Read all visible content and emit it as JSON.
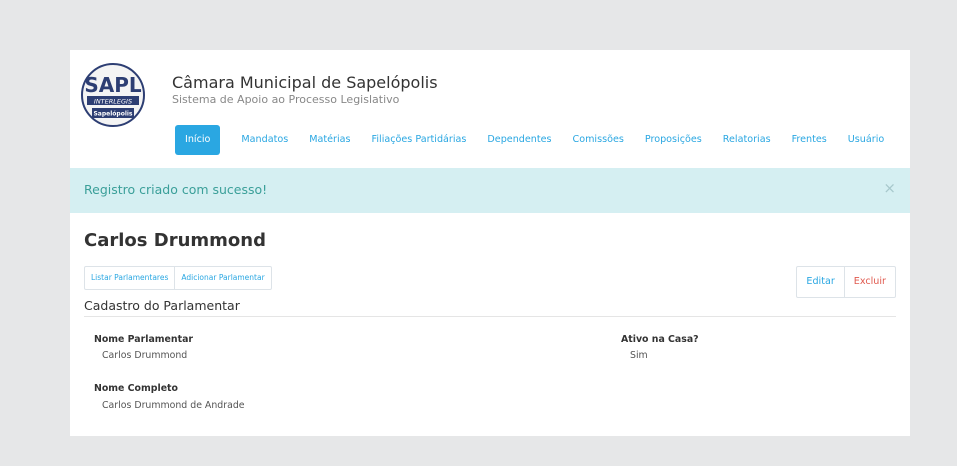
{
  "app": {
    "title": "Câmara Municipal de Sapelópolis",
    "subtitle": "Sistema de Apoio ao Processo Legislativo",
    "logo": {
      "wordmark": "SAPL",
      "band": "INTERLEGIS",
      "caption": "Sapelópolis"
    }
  },
  "nav": {
    "items": [
      {
        "label": "Início",
        "active": true
      },
      {
        "label": "Mandatos",
        "active": false
      },
      {
        "label": "Matérias",
        "active": false
      },
      {
        "label": "Filiações Partidárias",
        "active": false
      },
      {
        "label": "Dependentes",
        "active": false
      },
      {
        "label": "Comissões",
        "active": false
      },
      {
        "label": "Proposições",
        "active": false
      },
      {
        "label": "Relatorias",
        "active": false
      },
      {
        "label": "Frentes",
        "active": false
      },
      {
        "label": "Usuário",
        "active": false
      }
    ]
  },
  "alert": {
    "message": "Registro criado com sucesso!",
    "close_glyph": "×"
  },
  "page": {
    "title": "Carlos Drummond",
    "subnav": {
      "list_label": "Listar Parlamentares",
      "add_label": "Adicionar Parlamentar"
    },
    "actions": {
      "edit_label": "Editar",
      "delete_label": "Excluir"
    },
    "section_title": "Cadastro do Parlamentar"
  },
  "fields": {
    "nome_parlamentar": {
      "label": "Nome Parlamentar",
      "value": "Carlos Drummond"
    },
    "ativo": {
      "label": "Ativo na Casa?",
      "value": "Sim"
    },
    "nome_completo": {
      "label": "Nome Completo",
      "value": "Carlos Drummond de Andrade"
    }
  },
  "colors": {
    "accent": "#2aa7e2",
    "alert_bg": "#d5eff2",
    "alert_text": "#3a9f99",
    "danger": "#e05a4f",
    "page_bg": "#e6e7e8"
  }
}
